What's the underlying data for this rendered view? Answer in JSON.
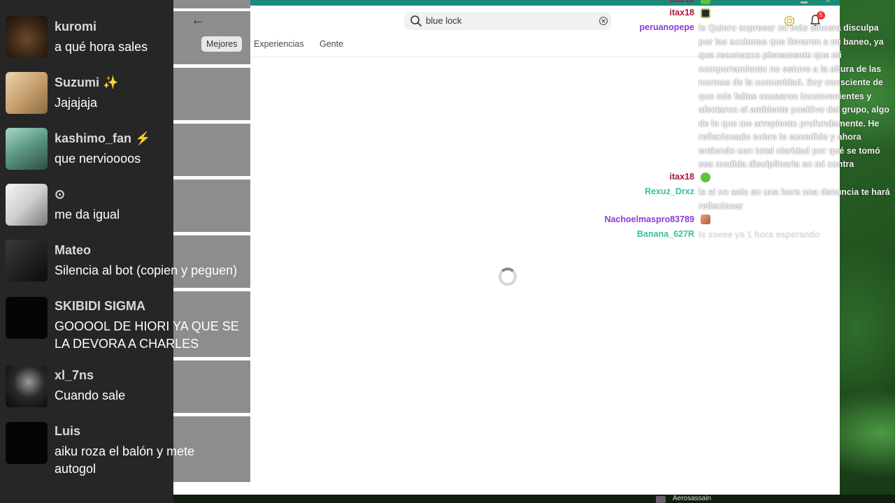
{
  "left_chat": {
    "messages": [
      {
        "user": "kuromi",
        "text": "a qué hora sales"
      },
      {
        "user": "Suzumi ✨",
        "text": "Jajajaja"
      },
      {
        "user": "kashimo_fan ⚡",
        "text": "que nervioooos"
      },
      {
        "user": "⊙",
        "text": "me da igual"
      },
      {
        "user": "Mateo",
        "text": "Silencia al bot (copien y peguen)"
      },
      {
        "user": "SKIBIDI SIGMA",
        "text": "GOOOOL DE HIORI YA QUE SE LA DEVORA A CHARLES"
      },
      {
        "user": "xl_7ns",
        "text": "Cuando sale"
      },
      {
        "user": "Luis",
        "text": "aiku roza el balón y mete autogol"
      }
    ]
  },
  "app": {
    "search": {
      "value": "blue lock"
    },
    "tabs": [
      "Mejores",
      "Experiencias",
      "Gente"
    ],
    "active_tab": "Mejores",
    "notification_count": "5",
    "icons": {
      "back": "back-arrow-icon",
      "search": "search-icon",
      "clear": "clear-search-icon",
      "robux": "robux-icon",
      "bell": "notifications-bell-icon",
      "loading": "loading-spinner-icon"
    },
    "accent_color": "#1b8a78"
  },
  "right_chat": {
    "messages": [
      {
        "user": "itax18",
        "text": ""
      },
      {
        "user": "peruanopepe",
        "text": "ls Quiero expresar mi más sincera disculpa por las acciones que llevaron a mi baneo, ya que reconozco plenamente que mi comportamiento no estuvo a la altura de las normas de la comunidad. Soy consciente de que mis faltas causaron inconvenientes y afectaron el ambiente positivo del grupo, algo de lo que me arrepiento profundamente. He reflexionado sobre lo sucedido y ahora entiendo con total claridad por qué se tomó esa medida disciplinaria en mi contra"
      },
      {
        "user": "itax18",
        "text": ""
      },
      {
        "user": "Rexuz_Drxz",
        "text": "ls si no sale en una hora una denuncia te hará reflexionar"
      },
      {
        "user": "Nachoelmaspro83789",
        "text": ""
      },
      {
        "user": "Banana_627R",
        "text": "ls xeeee ya 1 hora esperando"
      }
    ],
    "name_colors": {
      "itax18": "#b3123c",
      "peruanopepe": "#8d3bd6",
      "Rexuz_Drxz": "#3bbfa0",
      "Nachoelmaspro83789": "#8d3bd6",
      "Banana_627R": "#3bbfa0"
    }
  },
  "taskbar": {
    "app_label": "Aerosassain"
  }
}
